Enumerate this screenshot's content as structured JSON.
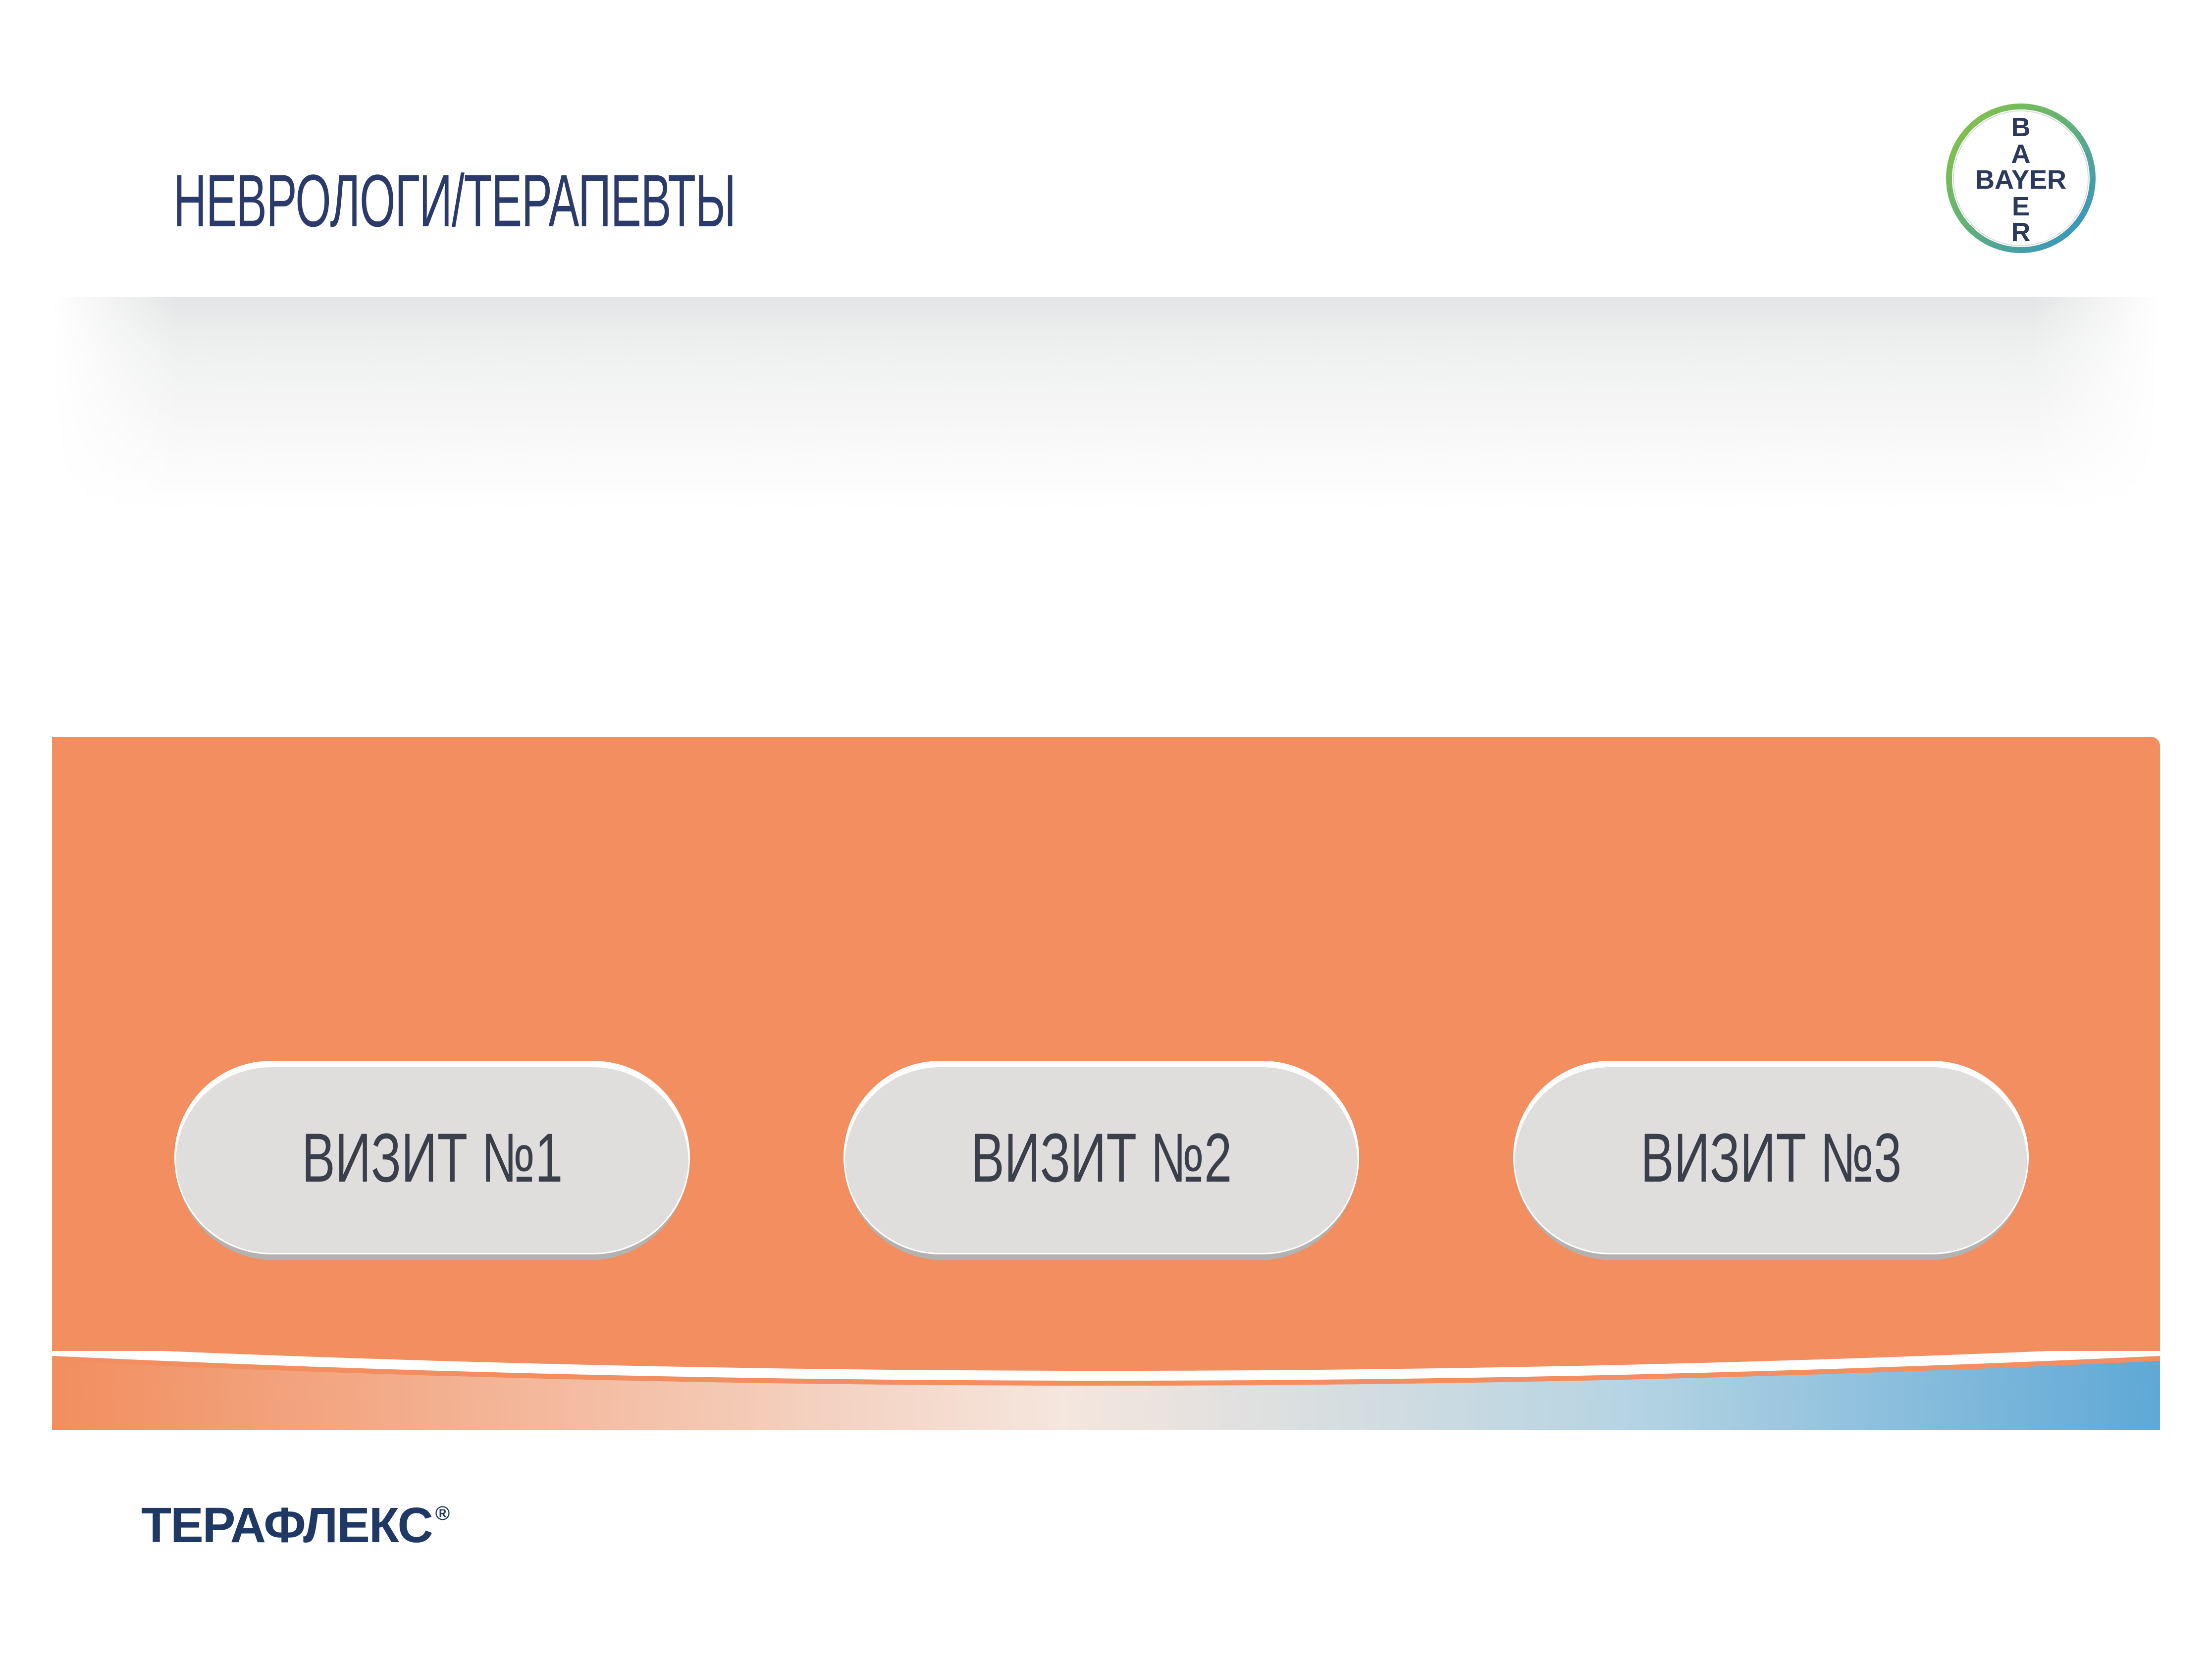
{
  "header": {
    "title": "НЕВРОЛОГИ/ТЕРАПЕВТЫ",
    "logo": {
      "name": "bayer-cross-logo",
      "horizontal": "BAYER",
      "vertical": [
        "B",
        "A",
        "Y",
        "E",
        "R"
      ]
    }
  },
  "visits": [
    {
      "label": "ВИЗИТ №1"
    },
    {
      "label": "ВИЗИТ №2"
    },
    {
      "label": "ВИЗИТ №3"
    }
  ],
  "footer": {
    "product_name": "ТЕРАФЛЕКС",
    "registered_mark": "®"
  },
  "colors": {
    "panel": "#f28e5f",
    "title": "#2a3b6b",
    "button_face": "#e0dedd",
    "button_edge": "#b4b2b1",
    "button_text": "#3a3f4a",
    "product_name": "#1f3864",
    "logo_ring_green": "#7ab648",
    "logo_ring_blue": "#3a9bd5"
  }
}
